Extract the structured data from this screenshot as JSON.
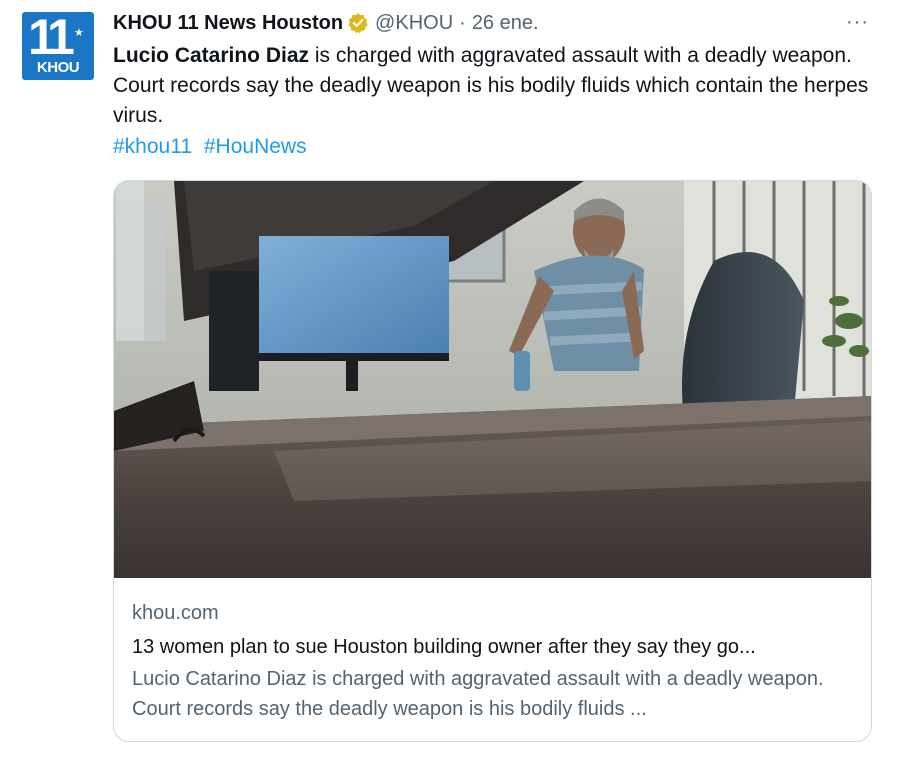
{
  "tweet": {
    "avatar": {
      "number": "11",
      "brand": "KHOU",
      "color": "#1b76c5"
    },
    "author_name": "KHOU 11 News Houston",
    "verified_icon": "verified-gold-badge-icon",
    "handle": "@KHOU",
    "separator": "·",
    "date": "26 ene.",
    "more_icon": "···",
    "text_bold": "Lucio Catarino Diaz",
    "text_rest": " is charged with aggravated assault with a deadly weapon. Court records say the deadly weapon is his bodily fluids which contain the herpes virus.",
    "hashtags": [
      "#khou11",
      "#HouNews"
    ],
    "link_color": "#1d9bf0"
  },
  "card": {
    "domain": "khou.com",
    "title": "13 women plan to sue Houston building owner after they say they go...",
    "description": "Lucio Catarino Diaz is charged with aggravated assault with a deadly weapon. Court records say the deadly weapon is his bodily fluids ..."
  }
}
